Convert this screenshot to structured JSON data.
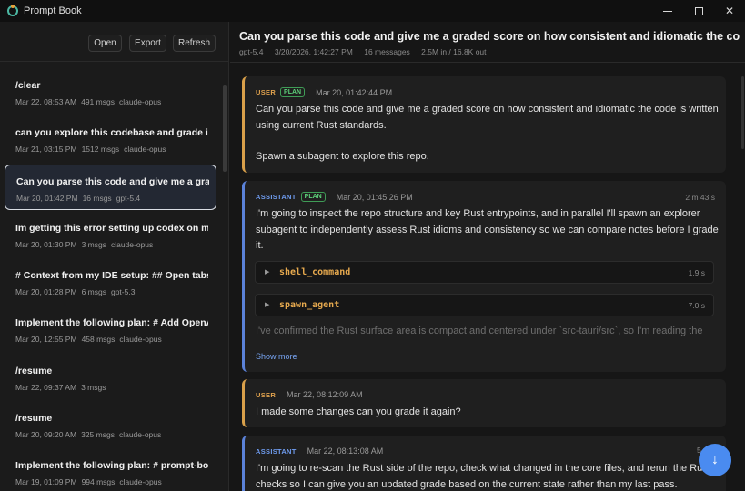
{
  "app": {
    "title": "Prompt Book"
  },
  "toolbar": {
    "open_label": "Open",
    "export_label": "Export",
    "refresh_label": "Refresh"
  },
  "sessions": [
    {
      "title": "/clear",
      "date": "Mar 22, 08:53 AM",
      "msgs": "491 msgs",
      "model": "claude-opus"
    },
    {
      "title": "can you explore this codebase and grade it a...",
      "date": "Mar 21, 03:15 PM",
      "msgs": "1512 msgs",
      "model": "claude-opus"
    },
    {
      "title": "Can you parse this code and give me a grade...",
      "date": "Mar 20, 01:42 PM",
      "msgs": "16 msgs",
      "model": "gpt-5.4"
    },
    {
      "title": "Im getting this error setting up codex on my ...",
      "date": "Mar 20, 01:30 PM",
      "msgs": "3 msgs",
      "model": "claude-opus"
    },
    {
      "title": "# Context from my IDE setup: ## Open tabs: ...",
      "date": "Mar 20, 01:28 PM",
      "msgs": "6 msgs",
      "model": "gpt-5.3"
    },
    {
      "title": "Implement the following plan: # Add OpenAI...",
      "date": "Mar 20, 12:55 PM",
      "msgs": "458 msgs",
      "model": "claude-opus"
    },
    {
      "title": "/resume",
      "date": "Mar 22, 09:37 AM",
      "msgs": "3 msgs",
      "model": ""
    },
    {
      "title": "/resume",
      "date": "Mar 20, 09:20 AM",
      "msgs": "325 msgs",
      "model": "claude-opus"
    },
    {
      "title": "Implement the following plan: # prompt-boo...",
      "date": "Mar 19, 01:09 PM",
      "msgs": "994 msgs",
      "model": "claude-opus"
    }
  ],
  "conversation": {
    "title": "Can you parse this code and give me a graded score on how consistent and idiomatic the code is writt",
    "model": "gpt-5.4",
    "date": "3/20/2026, 1:42:27 PM",
    "messages": "16 messages",
    "tokens": "2.5M in / 16.8K out"
  },
  "messages": [
    {
      "role": "USER",
      "badge": "PLAN",
      "time": "Mar 20, 01:42:44 PM",
      "text1": "Can you parse this code and give me a graded score on how consistent and idiomatic the code is written using current Rust standards.",
      "text2": "Spawn a subagent to explore this repo."
    },
    {
      "role": "ASSISTANT",
      "badge": "PLAN",
      "time": "Mar 20, 01:45:26 PM",
      "duration": "2 m 43 s",
      "text": "I'm going to inspect the repo structure and key Rust entrypoints, and in parallel I'll spawn an explorer subagent to independently assess Rust idioms and consistency so we can compare notes before I grade it.",
      "tools": [
        {
          "name": "shell_command",
          "duration": "1.9 s"
        },
        {
          "name": "spawn_agent",
          "duration": "7.0 s"
        }
      ],
      "faded": "I've confirmed the Rust surface area is compact and centered under `src-tauri/src`, so I'm reading the",
      "show_more": "Show more"
    },
    {
      "role": "USER",
      "time": "Mar 22, 08:12:09 AM",
      "text": "I made some changes can you grade it again?"
    },
    {
      "role": "ASSISTANT",
      "time": "Mar 22, 08:13:08 AM",
      "duration": "5",
      "text": "I'm going to re-scan the Rust side of the repo, check what changed in the core files, and rerun the Rust checks so I can give you an updated grade based on the current state rather than my last pass."
    }
  ],
  "scroll_button": {
    "icon": "↓"
  }
}
